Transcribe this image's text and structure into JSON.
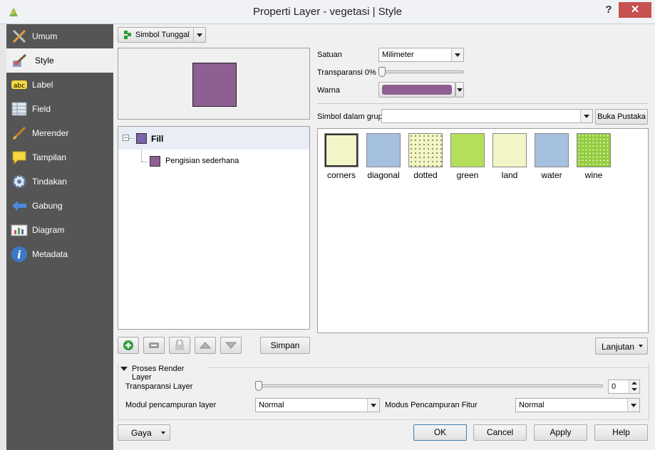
{
  "window": {
    "title": "Properti Layer - vegetasi | Style",
    "help_glyph": "?",
    "close_glyph": "✕"
  },
  "sidebar": {
    "items": [
      {
        "label": "Umum",
        "icon": "tools-icon"
      },
      {
        "label": "Style",
        "icon": "paint-brush-icon"
      },
      {
        "label": "Label",
        "icon": "abc-label-icon"
      },
      {
        "label": "Field",
        "icon": "table-icon"
      },
      {
        "label": "Merender",
        "icon": "brush-icon"
      },
      {
        "label": "Tampilan",
        "icon": "speech-bubble-icon"
      },
      {
        "label": "Tindakan",
        "icon": "gear-icon"
      },
      {
        "label": "Gabung",
        "icon": "join-arrow-icon"
      },
      {
        "label": "Diagram",
        "icon": "chart-icon"
      },
      {
        "label": "Metadata",
        "icon": "info-icon"
      }
    ],
    "active_index": 1
  },
  "renderer": {
    "type_label": "Simbol Tunggal"
  },
  "symbol_tree": {
    "root_label": "Fill",
    "child_label": "Pengisian sederhana",
    "fill_color": "#8e5f92",
    "icon_color": "#7a63a8"
  },
  "properties": {
    "unit_label": "Satuan",
    "unit_value": "Milimeter",
    "transparency_label": "Transparansi 0%",
    "color_label": "Warna",
    "color_value": "#8e5f92"
  },
  "group": {
    "label": "Simbol dalam grup",
    "value": "",
    "library_button": "Buka Pustaka"
  },
  "symbols": [
    {
      "name": "corners",
      "color": "#f2f5c6",
      "pattern": "corners"
    },
    {
      "name": "diagonal",
      "color": "#a6c0df",
      "pattern": "solid"
    },
    {
      "name": "dotted",
      "color": "#f2f5c6",
      "pattern": "dots"
    },
    {
      "name": "green",
      "color": "#b4df5b",
      "pattern": "solid"
    },
    {
      "name": "land",
      "color": "#f2f5c6",
      "pattern": "solid"
    },
    {
      "name": "water",
      "color": "#a6c0df",
      "pattern": "solid"
    },
    {
      "name": "wine",
      "color": "#92cc3c",
      "pattern": "dots-dark"
    }
  ],
  "toolbar": {
    "save_label": "Simpan",
    "advanced_label": "Lanjutan"
  },
  "render": {
    "section_label": "Proses Render Layer",
    "transparency_label": "Transparansi Layer",
    "transparency_value": "0",
    "blend_layer_label": "Modul pencampuran layer",
    "blend_layer_value": "Normal",
    "blend_feature_label": "Modus Pencampuran Fitur",
    "blend_feature_value": "Normal"
  },
  "footer": {
    "style_label": "Gaya",
    "ok_label": "OK",
    "cancel_label": "Cancel",
    "apply_label": "Apply",
    "help_label": "Help"
  }
}
